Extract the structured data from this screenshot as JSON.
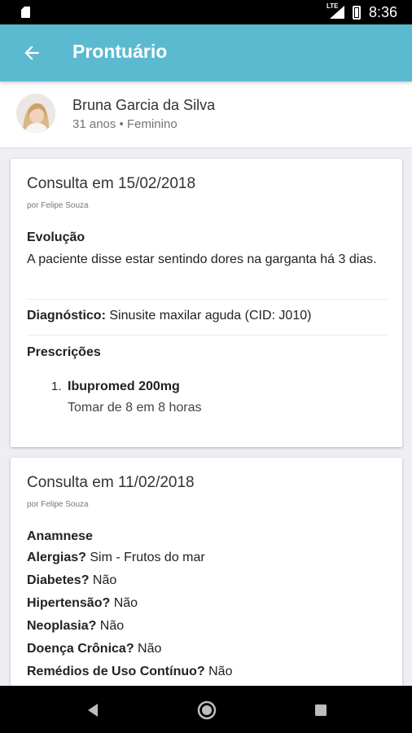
{
  "status_bar": {
    "time": "8:36",
    "network": "LTE"
  },
  "app_bar": {
    "title": "Prontuário",
    "back_icon": "arrow-left-icon"
  },
  "colors": {
    "primary": "#5bbad0",
    "background": "#eeeff3"
  },
  "patient": {
    "name": "Bruna Garcia da Silva",
    "meta": "31 anos • Feminino"
  },
  "consultations": [
    {
      "title": "Consulta em 15/02/2018",
      "author": "por Felipe Souza",
      "evolution_label": "Evolução",
      "evolution_text": "A paciente disse estar sentindo dores na garganta há 3 dias.",
      "diagnosis_label": "Diagnóstico:",
      "diagnosis_value": " Sinusite maxilar aguda (CID: J010)",
      "prescriptions_label": "Prescrições",
      "prescriptions": [
        {
          "number": "1.",
          "drug": "Ibupromed 200mg",
          "instructions": "Tomar de 8 em 8 horas"
        }
      ]
    },
    {
      "title": "Consulta em 11/02/2018",
      "author": "por Felipe Souza",
      "anamnese_label": "Anamnese",
      "anamnese": [
        {
          "label": "Alergias?",
          "value": " Sim - Frutos do mar"
        },
        {
          "label": "Diabetes?",
          "value": " Não"
        },
        {
          "label": "Hipertensão?",
          "value": " Não"
        },
        {
          "label": "Neoplasia?",
          "value": " Não"
        },
        {
          "label": "Doença Crônica?",
          "value": " Não"
        },
        {
          "label": "Remédios de Uso Contínuo?",
          "value": " Não"
        }
      ]
    }
  ],
  "nav_bar": {
    "back_icon": "nav-back-icon",
    "home_icon": "nav-home-icon",
    "recents_icon": "nav-recents-icon"
  }
}
